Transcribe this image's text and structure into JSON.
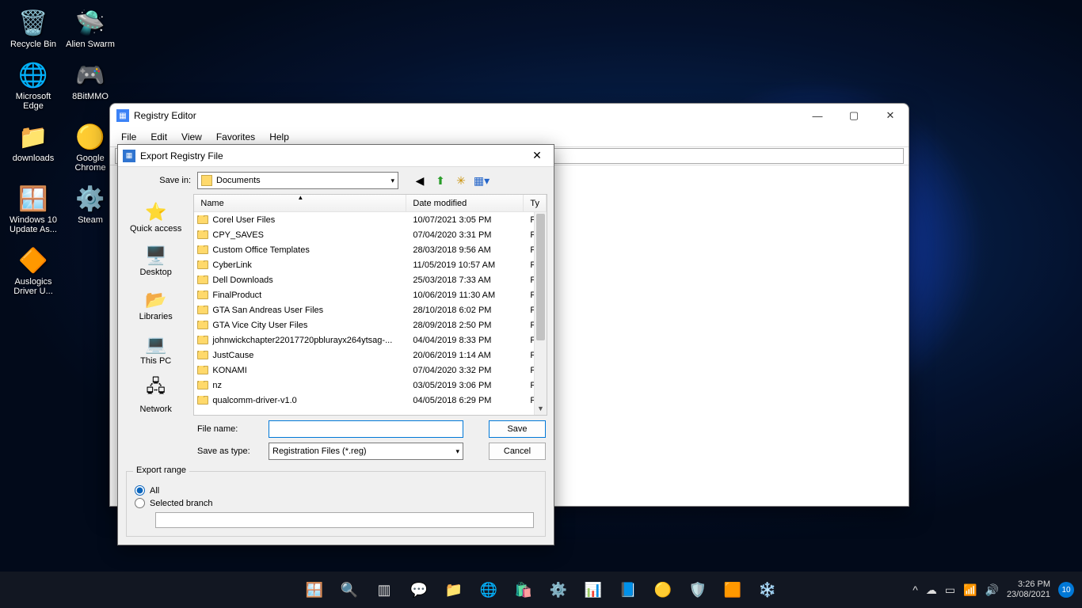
{
  "desktop_icons": [
    {
      "name": "recycle-bin",
      "label": "Recycle Bin",
      "glyph": "🗑️"
    },
    {
      "name": "alien-swarm",
      "label": "Alien Swarm",
      "glyph": "🛸"
    },
    {
      "name": "microsoft-edge",
      "label": "Microsoft Edge",
      "glyph": "🌐"
    },
    {
      "name": "8bitmmo",
      "label": "8BitMMO",
      "glyph": "🎮"
    },
    {
      "name": "downloads",
      "label": "downloads",
      "glyph": "📁"
    },
    {
      "name": "google-chrome",
      "label": "Google Chrome",
      "glyph": "🟡"
    },
    {
      "name": "win10-update",
      "label": "Windows 10 Update As...",
      "glyph": "🪟"
    },
    {
      "name": "steam",
      "label": "Steam",
      "glyph": "⚙️"
    },
    {
      "name": "auslogics",
      "label": "Auslogics Driver U...",
      "glyph": "🔶"
    }
  ],
  "regedit": {
    "title": "Registry Editor",
    "menu": [
      "File",
      "Edit",
      "View",
      "Favorites",
      "Help"
    ]
  },
  "export": {
    "title": "Export Registry File",
    "savein_label": "Save in:",
    "savein_value": "Documents",
    "places": [
      {
        "name": "quick-access",
        "label": "Quick access",
        "glyph": "⭐"
      },
      {
        "name": "desktop",
        "label": "Desktop",
        "glyph": "🖥️"
      },
      {
        "name": "libraries",
        "label": "Libraries",
        "glyph": "📂"
      },
      {
        "name": "this-pc",
        "label": "This PC",
        "glyph": "💻"
      },
      {
        "name": "network",
        "label": "Network",
        "glyph": "🖧"
      }
    ],
    "columns": {
      "name": "Name",
      "date": "Date modified",
      "type": "Ty"
    },
    "files": [
      {
        "name": "Corel User Files",
        "date": "10/07/2021 3:05 PM",
        "type": "Fil"
      },
      {
        "name": "CPY_SAVES",
        "date": "07/04/2020 3:31 PM",
        "type": "Fil"
      },
      {
        "name": "Custom Office Templates",
        "date": "28/03/2018 9:56 AM",
        "type": "Fil"
      },
      {
        "name": "CyberLink",
        "date": "11/05/2019 10:57 AM",
        "type": "Fil"
      },
      {
        "name": "Dell Downloads",
        "date": "25/03/2018 7:33 AM",
        "type": "Fil"
      },
      {
        "name": "FinalProduct",
        "date": "10/06/2019 11:30 AM",
        "type": "Fil"
      },
      {
        "name": "GTA San Andreas User Files",
        "date": "28/10/2018 6:02 PM",
        "type": "Fil"
      },
      {
        "name": "GTA Vice City User Files",
        "date": "28/09/2018 2:50 PM",
        "type": "Fil"
      },
      {
        "name": "johnwickchapter22017720pblurayx264ytsag-...",
        "date": "04/04/2019 8:33 PM",
        "type": "Fil"
      },
      {
        "name": "JustCause",
        "date": "20/06/2019 1:14 AM",
        "type": "Fil"
      },
      {
        "name": "KONAMI",
        "date": "07/04/2020 3:32 PM",
        "type": "Fil"
      },
      {
        "name": "nz",
        "date": "03/05/2019 3:06 PM",
        "type": "Fil"
      },
      {
        "name": "qualcomm-driver-v1.0",
        "date": "04/05/2018 6:29 PM",
        "type": "Fil"
      }
    ],
    "filename_label": "File name:",
    "filename_value": "",
    "savetype_label": "Save as type:",
    "savetype_value": "Registration Files (*.reg)",
    "save_btn": "Save",
    "cancel_btn": "Cancel",
    "range_legend": "Export range",
    "range_all": "All",
    "range_sel": "Selected branch",
    "branch_value": ""
  },
  "taskbar": {
    "time": "3:26 PM",
    "date": "23/08/2021",
    "notif": "10"
  }
}
